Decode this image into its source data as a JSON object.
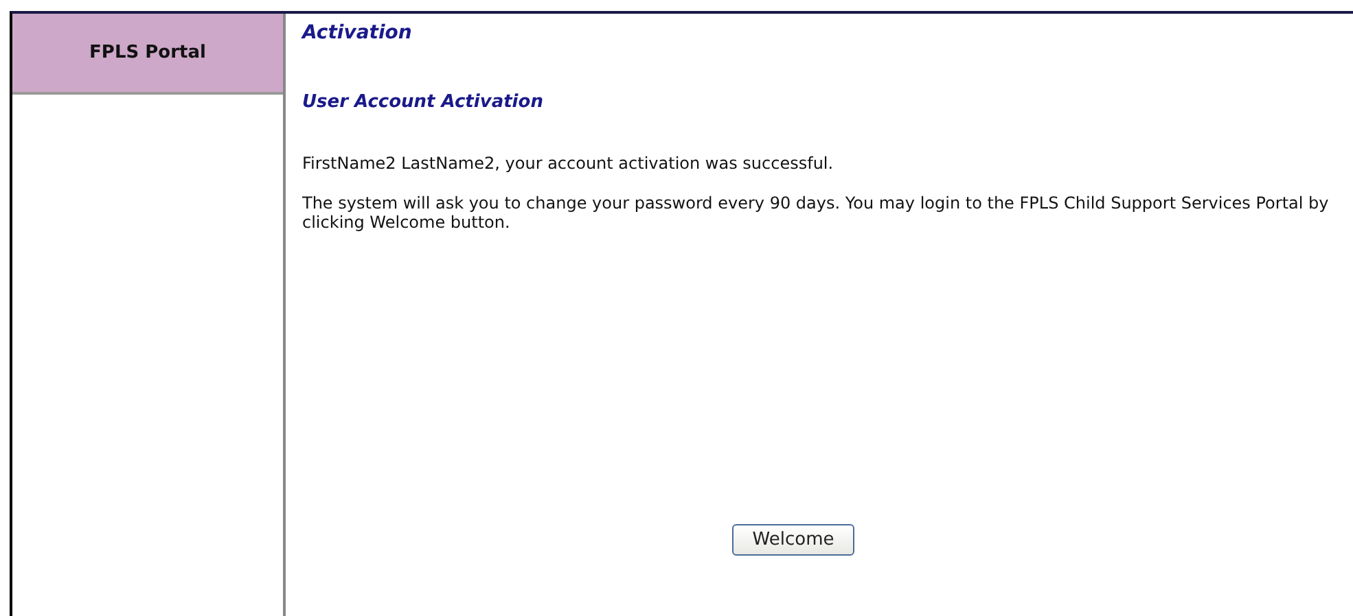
{
  "sidebar": {
    "title": "FPLS Portal"
  },
  "page_title": "Activation",
  "section_title": "User Account Activation",
  "paragraphs": [
    "FirstName2 LastName2, your account activation was successful.",
    "The system will ask you to change your password every 90 days. You may login to the FPLS Child Support Services Portal by clicking Welcome button."
  ],
  "buttons": [
    "Welcome"
  ]
}
